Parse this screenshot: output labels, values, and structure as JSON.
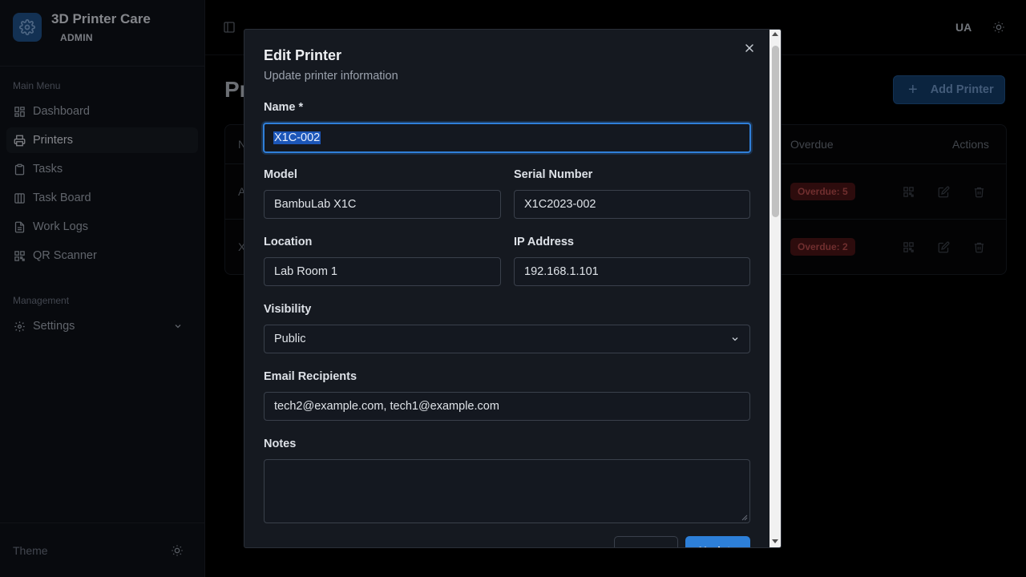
{
  "app": {
    "title": "3D Printer Care",
    "role": "ADMIN"
  },
  "sidebar": {
    "main_menu_label": "Main Menu",
    "items": [
      {
        "label": "Dashboard",
        "icon": "dashboard-icon"
      },
      {
        "label": "Printers",
        "icon": "printer-icon",
        "active": true
      },
      {
        "label": "Tasks",
        "icon": "clipboard-icon"
      },
      {
        "label": "Task Board",
        "icon": "kanban-icon"
      },
      {
        "label": "Work Logs",
        "icon": "file-text-icon"
      },
      {
        "label": "QR Scanner",
        "icon": "qr-code-icon"
      }
    ],
    "management_label": "Management",
    "settings_label": "Settings",
    "theme_label": "Theme"
  },
  "header": {
    "user_initials": "UA"
  },
  "main": {
    "page_title": "Pr",
    "add_button": "Add Printer",
    "table": {
      "headers": [
        "N",
        "Overdue",
        "Actions"
      ],
      "rows": [
        {
          "first": "A",
          "overdue": "Overdue: 5"
        },
        {
          "first": "X",
          "overdue": "Overdue: 2"
        }
      ]
    }
  },
  "dialog": {
    "title": "Edit Printer",
    "subtitle": "Update printer information",
    "fields": {
      "name": {
        "label": "Name *",
        "value": "X1C-002"
      },
      "model": {
        "label": "Model",
        "value": "BambuLab X1C"
      },
      "serial": {
        "label": "Serial Number",
        "value": "X1C2023-002"
      },
      "location": {
        "label": "Location",
        "value": "Lab Room 1"
      },
      "ip": {
        "label": "IP Address",
        "value": "192.168.1.101"
      },
      "visibility": {
        "label": "Visibility",
        "value": "Public"
      },
      "email": {
        "label": "Email Recipients",
        "value": "tech2@example.com, tech1@example.com"
      },
      "notes": {
        "label": "Notes",
        "value": ""
      }
    },
    "cancel_label": "Cancel",
    "update_label": "Update"
  },
  "colors": {
    "accent": "#2d7fd8",
    "badge_bg": "#4a1416",
    "badge_text": "#b44b4b",
    "dialog_bg": "#151920"
  }
}
